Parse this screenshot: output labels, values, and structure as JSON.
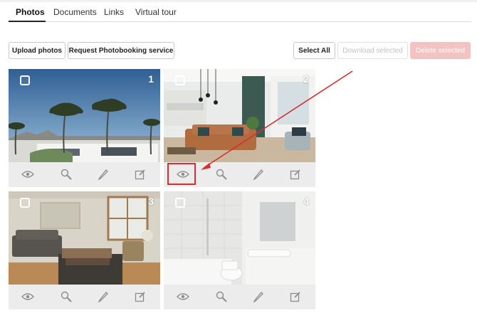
{
  "tabs": [
    {
      "label": "Photos",
      "active": true
    },
    {
      "label": "Documents",
      "active": false
    },
    {
      "label": "Links",
      "active": false
    },
    {
      "label": "Virtual tour",
      "active": false
    }
  ],
  "toolbar": {
    "upload_label": "Upload photos",
    "request_label": "Request Photobooking service",
    "select_all_label": "Select All",
    "download_label": "Download selected",
    "delete_label": "Delete selected"
  },
  "photos": [
    {
      "number": "1",
      "scene": "palm trees exterior"
    },
    {
      "number": "2",
      "scene": "living room with leather sofa"
    },
    {
      "number": "3",
      "scene": "living room with grey sofa"
    },
    {
      "number": "4",
      "scene": "white bathroom"
    }
  ],
  "photo_tools": [
    "eye-icon",
    "magnifier-icon",
    "pencil-icon",
    "edit-icon"
  ],
  "colors": {
    "annotation_red": "#d72e2e",
    "delete_button_bg": "#f3c2c2",
    "tool_strip_bg": "#ececec"
  }
}
